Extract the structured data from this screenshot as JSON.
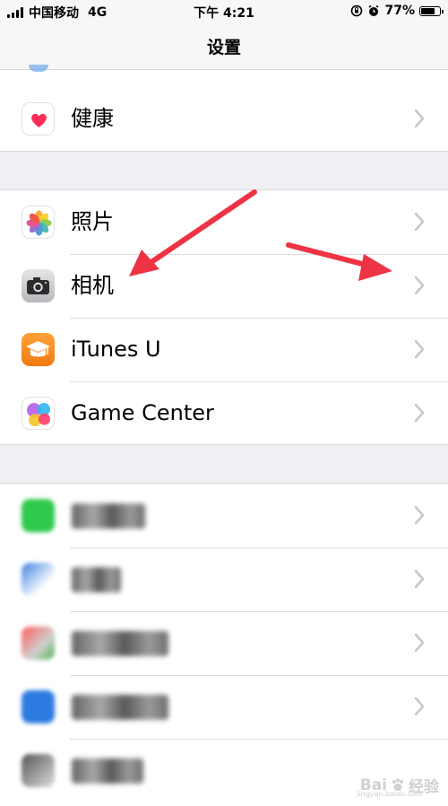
{
  "status_bar": {
    "carrier": "中国移动",
    "network": "4G",
    "time": "下午 4:21",
    "battery_percent": "77%",
    "battery_level": 0.77,
    "icons": [
      "signal-bars-icon",
      "orientation-lock-icon",
      "alarm-icon",
      "battery-icon"
    ]
  },
  "nav": {
    "title": "设置"
  },
  "groups": {
    "health": {
      "items": [
        {
          "label": "健康",
          "icon": "heart-icon"
        }
      ]
    },
    "media": {
      "items": [
        {
          "label": "照片",
          "icon": "photos-icon"
        },
        {
          "label": "相机",
          "icon": "camera-icon"
        },
        {
          "label": "iTunes U",
          "icon": "graduation-cap-icon"
        },
        {
          "label": "Game Center",
          "icon": "game-center-icon"
        }
      ]
    },
    "third_party": {
      "items": [
        {
          "icon": "app-icon"
        },
        {
          "icon": "app-icon"
        },
        {
          "icon": "app-icon"
        },
        {
          "icon": "app-icon"
        },
        {
          "icon": "app-icon"
        }
      ]
    }
  },
  "colors": {
    "background": "#efeff4",
    "accent_arrow": "#ee3344",
    "chevron": "#c7c7cc",
    "itunes_u": "#f5891f"
  },
  "watermark": {
    "text": "Bai",
    "suffix": "经验",
    "sub": "jingyan.baidu.com"
  }
}
